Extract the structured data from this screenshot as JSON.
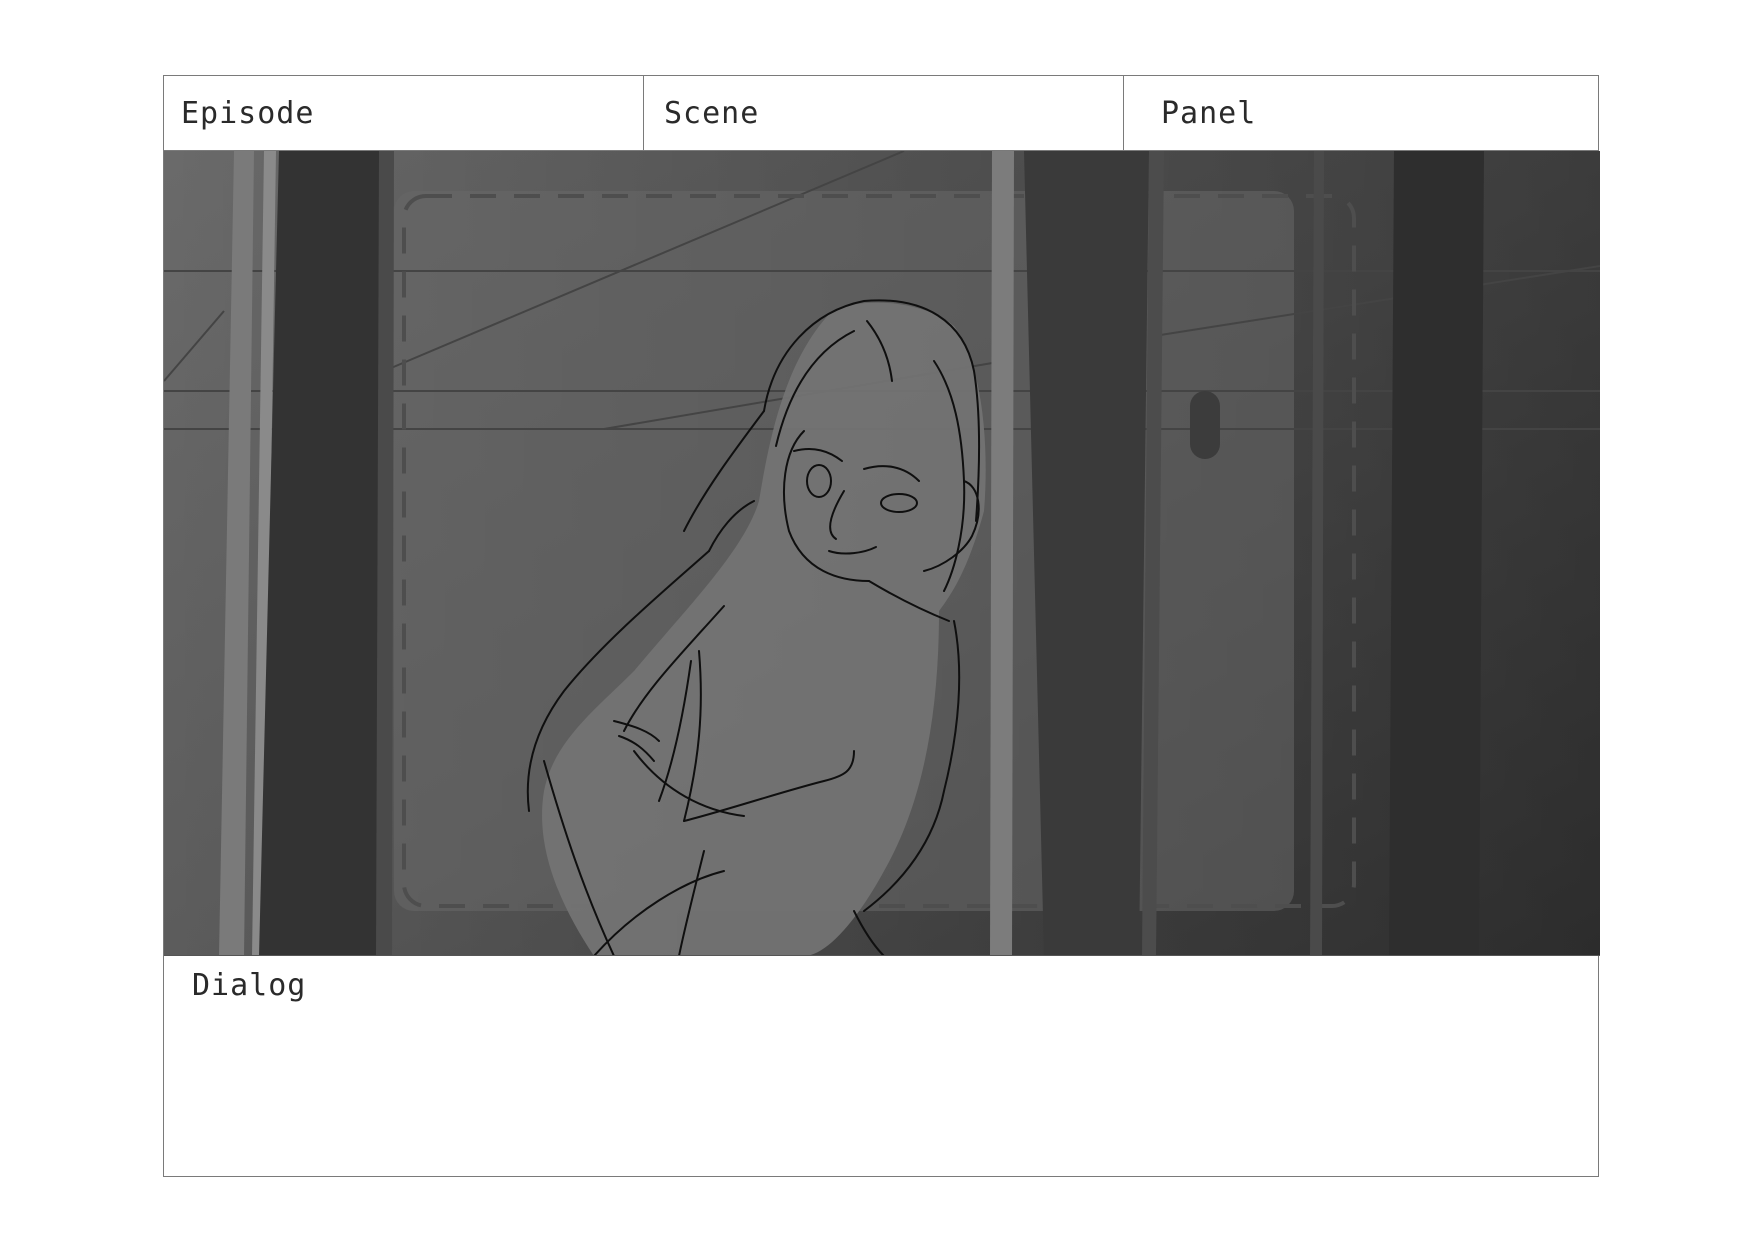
{
  "header": {
    "episode_label": "Episode",
    "scene_label": "Scene",
    "panel_label": "Panel"
  },
  "panel": {
    "content": "sketch",
    "colors": {
      "background": "#5e5e5e",
      "figure_fill": "#727272",
      "dark_pillar": "#3a3a3a",
      "line": "#111111"
    }
  },
  "dialog": {
    "label": "Dialog"
  }
}
